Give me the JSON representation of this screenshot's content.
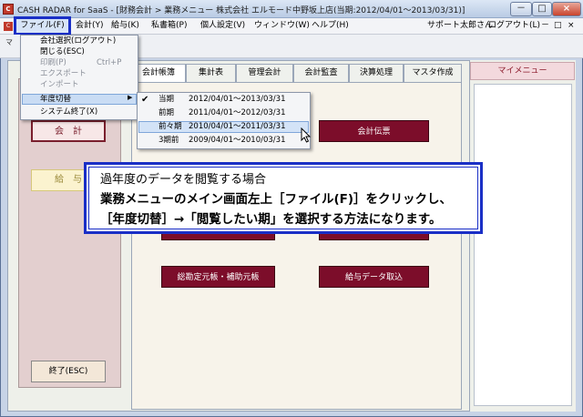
{
  "window": {
    "title": "CASH RADAR for SaaS - [財務会計 > 業務メニュー 株式会社 エルモード中野坂上店(当期:2012/04/01～2013/03/31)]",
    "min_label": "－",
    "max_label": "□",
    "close_label": "×"
  },
  "menubar": {
    "items": [
      "ファイル(F)",
      "会計(Y)",
      "給与(K)",
      "私書箱(P)",
      "個人設定(V)",
      "ウィンドウ(W)",
      "ヘルプ(H)"
    ],
    "user": "サポート太郎さん",
    "logout": "ログアウト(L)",
    "min_label": "－",
    "max_label": "□",
    "close_label": "×"
  },
  "toolbar": {
    "caption": "マ"
  },
  "file_menu": {
    "items": [
      {
        "label": "会社選択(ログアウト)",
        "shortcut": "",
        "enabled": true
      },
      {
        "label": "閉じる(ESC)",
        "shortcut": "",
        "enabled": true
      },
      {
        "label": "印刷(P)",
        "shortcut": "Ctrl+P",
        "enabled": false
      },
      {
        "label": "エクスポート",
        "shortcut": "",
        "enabled": false
      },
      {
        "label": "インポート",
        "shortcut": "",
        "enabled": false
      },
      {
        "label": "年度切替",
        "shortcut": "",
        "enabled": true,
        "submenu": true
      },
      {
        "label": "システム終了(X)",
        "shortcut": "",
        "enabled": true
      }
    ],
    "arrow": "▶"
  },
  "year_submenu": {
    "check": "✔",
    "items": [
      {
        "name": "当期",
        "range": "2012/04/01～2013/03/31",
        "checked": true
      },
      {
        "name": "前期",
        "range": "2011/04/01～2012/03/31",
        "checked": false
      },
      {
        "name": "前々期",
        "range": "2010/04/01～2011/03/31",
        "checked": false,
        "highlighted": true
      },
      {
        "name": "3期前",
        "range": "2009/04/01～2010/03/31",
        "checked": false
      }
    ]
  },
  "tabs": [
    "会計帳簿",
    "集計表",
    "管理会計",
    "会計監査",
    "決算処理",
    "マスタ作成"
  ],
  "left_panel": {
    "kaikei": "会　計",
    "kyuyo": "給　与",
    "exit": "終了(ESC)"
  },
  "main_buttons": {
    "denpyo": "会計伝票",
    "motocho": "総勘定元帳・補助元帳",
    "torikomi": "給与データ取込"
  },
  "mymenu": {
    "title": "マイメニュー"
  },
  "annotation": {
    "line1": "過年度のデータを閲覧する場合",
    "line2": "業務メニューのメイン画面左上［ファイル(F)］をクリックし、",
    "line3": "［年度切替］→「閲覧したい期」を選択する方法になります。"
  },
  "colors": {
    "accent_blue": "#1a2fc6",
    "button_maroon": "#7c0d2a",
    "menu_highlight": "#c9dcf4"
  }
}
